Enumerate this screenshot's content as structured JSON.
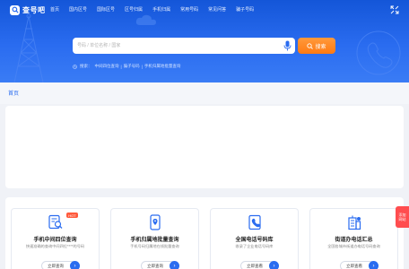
{
  "header": {
    "logo_text": "查号吧",
    "nav": [
      "首页",
      "国内区号",
      "国际区号",
      "区号归属",
      "手机归属",
      "常用号码",
      "常见问答",
      "骗子号码"
    ]
  },
  "search": {
    "placeholder": "号码 / 单位名称 / 国家",
    "button_label": "搜索"
  },
  "hot_search": {
    "label": "搜索：",
    "links": [
      "中间四位查询",
      "骗子号码",
      "手机归属地批量查询"
    ]
  },
  "breadcrumb": {
    "home": "首页"
  },
  "features": [
    {
      "title": "手机中间四位查询",
      "desc": "快速准确的查询中间四位****的号码",
      "button": "立即查询",
      "badge": "HOT"
    },
    {
      "title": "手机归属地批量查询",
      "desc": "手机号码归属地在线批量查询",
      "button": "立即查询"
    },
    {
      "title": "全国电话号码库",
      "desc": "收录了企业电话号码库",
      "button": "立即查看"
    },
    {
      "title": "街道办电话汇总",
      "desc": "全国各城市街道办电话号码查询",
      "button": "立即查看"
    }
  ],
  "side_float": {
    "line1": "添加",
    "line2": "网站"
  },
  "colors": {
    "primary": "#2a6cf0",
    "accent": "#ff7a12",
    "badge": "#ff5a3c",
    "float": "#ff4d4f"
  }
}
